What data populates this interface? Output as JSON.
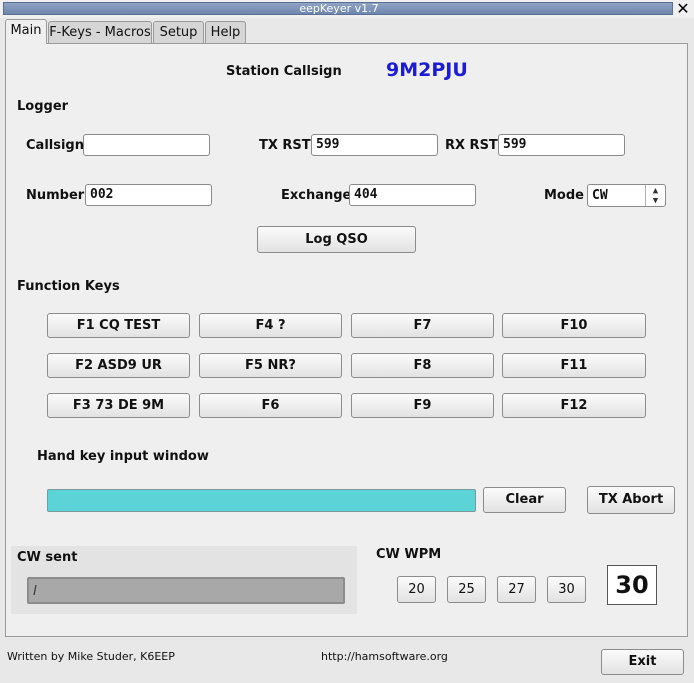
{
  "window": {
    "title": "eepKeyer v1.7",
    "close_icon": "close-icon"
  },
  "tabs": [
    {
      "label": "Main",
      "active": true
    },
    {
      "label": "F-Keys - Macros",
      "active": false
    },
    {
      "label": "Setup",
      "active": false
    },
    {
      "label": "Help",
      "active": false
    }
  ],
  "station": {
    "label": "Station Callsign",
    "callsign": "9M2PJU",
    "callsign_color": "#1c1cd6"
  },
  "logger": {
    "heading": "Logger",
    "callsign_label": "Callsign",
    "callsign_value": "",
    "tx_rst_label": "TX RST",
    "tx_rst_value": "599",
    "rx_rst_label": "RX RST",
    "rx_rst_value": "599",
    "number_label": "Number",
    "number_value": "002",
    "exchange_label": "Exchange",
    "exchange_value": "404",
    "mode_label": "Mode",
    "mode_value": "CW",
    "log_button": "Log QSO"
  },
  "function_keys": {
    "heading": "Function Keys",
    "keys": [
      "F1 CQ TEST",
      "F4 ?",
      "F7",
      "F10",
      "F2 ASD9 UR",
      "F5 NR?",
      "F8",
      "F11",
      "F3 73 DE 9M",
      "F6",
      "F9",
      "F12"
    ]
  },
  "hand_key": {
    "label": "Hand key input window",
    "value": "",
    "fill_color": "#5cd3d6",
    "clear_button": "Clear",
    "tx_abort_button": "TX Abort"
  },
  "cw_sent": {
    "label": "CW sent",
    "value": "l"
  },
  "cw_wpm": {
    "label": "CW WPM",
    "presets": [
      "20",
      "25",
      "27",
      "30"
    ],
    "current": "30"
  },
  "footer": {
    "author": "Written by Mike Studer, K6EEP",
    "url": "http://hamsoftware.org",
    "exit_button": "Exit"
  }
}
